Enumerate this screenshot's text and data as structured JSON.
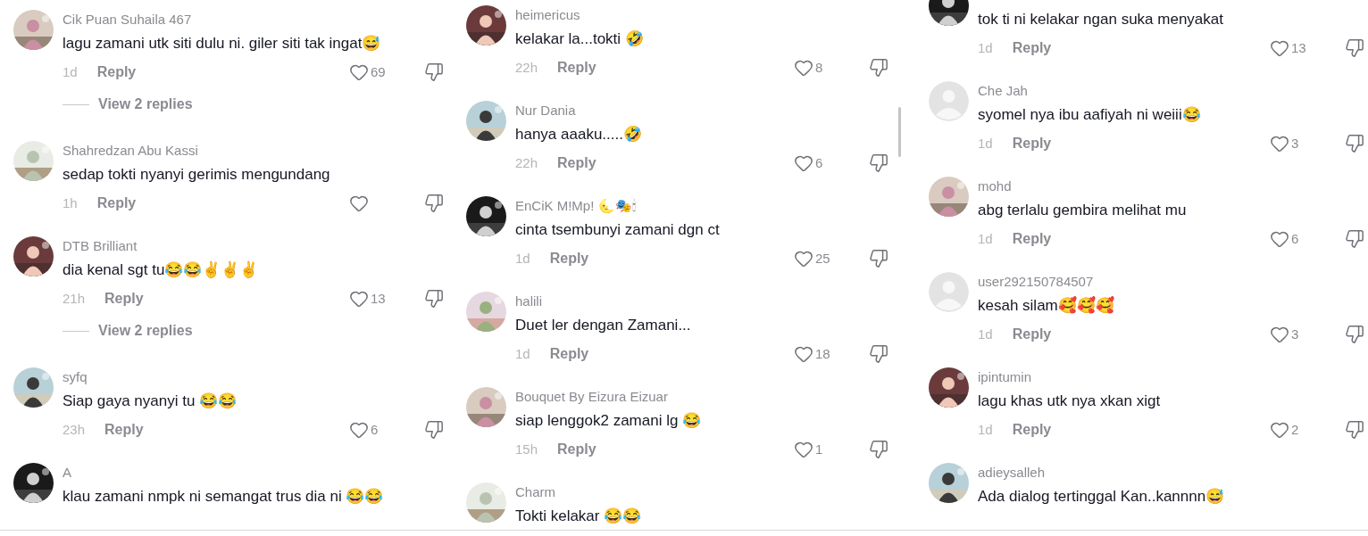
{
  "panels": [
    {
      "scrollbar": false,
      "comments": [
        {
          "user": "Cik Puan Suhaila 467",
          "text": "lagu zamani utk siti dulu ni. giler siti tak ingat😅",
          "time": "1d",
          "reply": "Reply",
          "likes": "69",
          "replies": "View 2 replies"
        },
        {
          "user": "Shahredzan Abu Kassi",
          "text": "sedap tokti nyanyi gerimis mengundang",
          "time": "1h",
          "reply": "Reply"
        },
        {
          "user": "DTB Brilliant",
          "text": "dia kenal sgt tu😂😂✌️✌️✌️",
          "time": "21h",
          "reply": "Reply",
          "likes": "13",
          "replies": "View 2 replies"
        },
        {
          "user": "syfq",
          "text": "Siap gaya nyanyi tu 😂😂",
          "time": "23h",
          "reply": "Reply",
          "likes": "6"
        },
        {
          "user": "A",
          "text": "klau zamani nmpk ni semangat trus dia ni 😂😂"
        }
      ]
    },
    {
      "scrollbar": true,
      "comments": [
        {
          "user": "heimericus",
          "text": "kelakar la...tokti 🤣",
          "time": "22h",
          "reply": "Reply",
          "likes": "8"
        },
        {
          "user": "Nur Dania",
          "text": "hanya aaaku.....🤣",
          "time": "22h",
          "reply": "Reply",
          "likes": "6"
        },
        {
          "user": "EnCiK M!Mp! 🌜🎭🕯",
          "text": "cinta tsembunyi zamani dgn ct",
          "time": "1d",
          "reply": "Reply",
          "likes": "25"
        },
        {
          "user": "halili",
          "text": "Duet ler dengan Zamani...",
          "time": "1d",
          "reply": "Reply",
          "likes": "18"
        },
        {
          "user": "Bouquet By Eizura Eizuar",
          "text": "siap lenggok2 zamani lg 😂",
          "time": "15h",
          "reply": "Reply",
          "likes": "1"
        },
        {
          "user": "Charm",
          "text": "Tokti kelakar 😂😂"
        }
      ]
    },
    {
      "scrollbar": false,
      "comments": [
        {
          "text": "tok ti ni kelakar ngan suka menyakat",
          "time": "1d",
          "reply": "Reply",
          "likes": "13"
        },
        {
          "user": "Che Jah",
          "avatar": {
            "kind": "default"
          },
          "text": "syomel nya ibu aafiyah ni weiii😂",
          "time": "1d",
          "reply": "Reply",
          "likes": "3"
        },
        {
          "user": "mohd",
          "text": "abg terlalu gembira melihat mu",
          "time": "1d",
          "reply": "Reply",
          "likes": "6"
        },
        {
          "user": "user292150784507",
          "avatar": {
            "kind": "default"
          },
          "text": "kesah silam🥰🥰🥰",
          "time": "1d",
          "reply": "Reply",
          "likes": "3"
        },
        {
          "user": "ipintumin",
          "text": "lagu khas utk nya xkan xigt",
          "time": "1d",
          "reply": "Reply",
          "likes": "2"
        },
        {
          "user": "adieysalleh",
          "text": "Ada dialog tertinggal Kan..kannnn😅"
        }
      ]
    }
  ]
}
